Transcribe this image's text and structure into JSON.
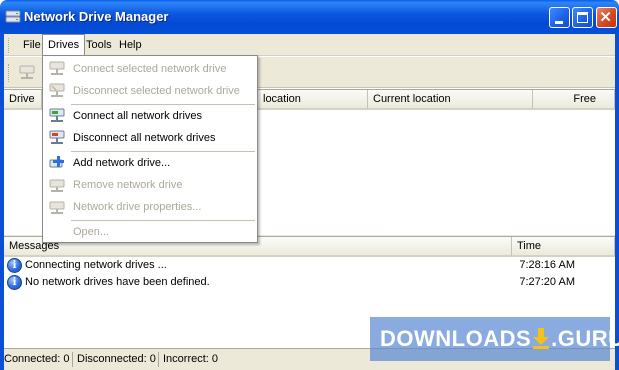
{
  "window": {
    "title": "Network Drive Manager",
    "icon": "network-drive-icon"
  },
  "menubar": {
    "items": [
      {
        "label": "File"
      },
      {
        "label": "Drives",
        "active": true
      },
      {
        "label": "Tools"
      },
      {
        "label": "Help"
      }
    ]
  },
  "drives_menu": {
    "items": [
      {
        "label": "Connect selected network drive",
        "enabled": false,
        "icon": "network-drive-icon"
      },
      {
        "label": "Disconnect selected network drive",
        "enabled": false,
        "icon": "network-drive-disconnect-icon"
      },
      {
        "label": "Connect all network drives",
        "enabled": true,
        "icon": "network-drive-connect-all-icon"
      },
      {
        "label": "Disconnect all network drives",
        "enabled": true,
        "icon": "network-drive-disconnect-all-icon"
      },
      {
        "label": "Add network drive...",
        "enabled": true,
        "icon": "add-drive-icon"
      },
      {
        "label": "Remove network drive",
        "enabled": false,
        "icon": "remove-drive-icon"
      },
      {
        "label": "Network drive properties...",
        "enabled": false,
        "icon": "drive-properties-icon"
      },
      {
        "label": "Open...",
        "enabled": false,
        "icon": ""
      }
    ]
  },
  "drive_list": {
    "columns": [
      {
        "label": "Drive"
      },
      {
        "label": "location"
      },
      {
        "label": "Current location"
      },
      {
        "label": "Free"
      }
    ]
  },
  "messages": {
    "columns": [
      {
        "label": "Messages"
      },
      {
        "label": "Time"
      }
    ],
    "rows": [
      {
        "text": "Connecting network drives ...",
        "time": "7:28:16 AM",
        "icon": "info-icon"
      },
      {
        "text": "No network drives have been defined.",
        "time": "7:27:20 AM",
        "icon": "info-icon"
      }
    ]
  },
  "statusbar": {
    "connected": "Connected: 0",
    "disconnected": "Disconnected: 0",
    "incorrect": "Incorrect: 0"
  },
  "watermark": {
    "left": "DOWNLOADS",
    "right": ".GURU"
  },
  "colors": {
    "titlebar": "#0a5ee8",
    "menu_bg": "#ece9d8",
    "disabled_text": "#aca899",
    "info_icon": "#2f6fe0"
  }
}
